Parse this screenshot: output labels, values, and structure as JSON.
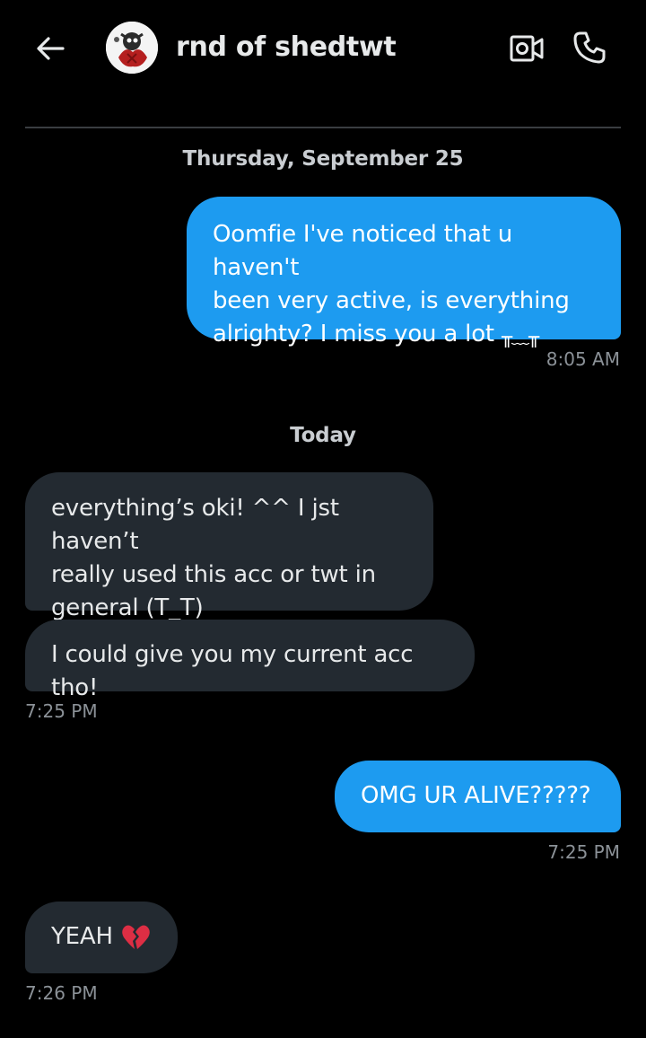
{
  "header": {
    "title": "rnd of shedtwt",
    "back_icon": "arrow-left-icon",
    "video_icon": "video-call-icon",
    "call_icon": "phone-icon"
  },
  "colors": {
    "background": "#000000",
    "outgoing_bubble": "#1d9bf0",
    "incoming_bubble": "#232a31",
    "timestamp": "#8b9197"
  },
  "conversation": {
    "date_1": "Thursday, September 25",
    "msg_1": {
      "text": "Oomfie I've noticed that u haven't been very active, is everything alrighty? I miss you a lot",
      "line_1": "Oomfie I've noticed that u haven't",
      "line_2": "been very active, is everything",
      "line_3": "alrighty? I miss you a lot",
      "kaomoji": "╥﹏╥",
      "time": "8:05 AM"
    },
    "date_2": "Today",
    "msg_2": {
      "line_1": "everything’s oki! ^^ I jst haven’t",
      "line_2": "really used this acc or twt in",
      "line_3": "general (T_T)"
    },
    "msg_3": {
      "text": "I could give you my current acc tho!",
      "time": "7:25 PM"
    },
    "msg_4": {
      "text": "OMG UR ALIVE?????",
      "time": "7:25 PM"
    },
    "msg_5": {
      "text": "YEAH",
      "emoji": "broken-heart-icon",
      "time": "7:26 PM"
    }
  }
}
